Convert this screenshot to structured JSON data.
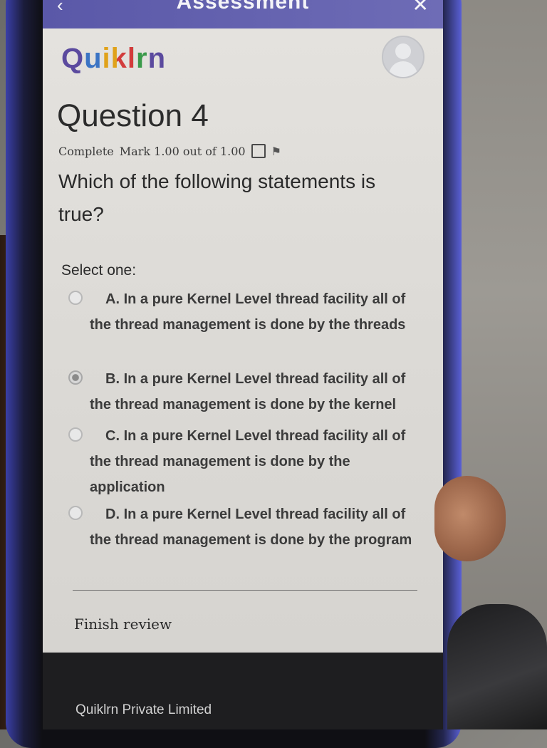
{
  "topbar": {
    "title": "Assessment",
    "back_icon": "chevron-left-icon",
    "close_icon": "close-icon"
  },
  "brand": {
    "logo_text_q": "Q",
    "logo_text_rest": "uiklrn"
  },
  "question": {
    "title": "Question 4",
    "status": "Complete",
    "mark": "Mark 1.00 out of 1.00",
    "text": "Which of the following statements is true?"
  },
  "prompt": "Select one:",
  "options": [
    {
      "letter": "A.",
      "text": "In a pure Kernel Level thread facility all of the thread management is done by the threads",
      "selected": false
    },
    {
      "letter": "B.",
      "text": "In a pure Kernel Level thread facility all of the thread management is done by the kernel",
      "selected": true
    },
    {
      "letter": "C.",
      "text": "In a pure Kernel Level thread facility all of the thread management is done by the application",
      "selected": false
    },
    {
      "letter": "D.",
      "text": "In a pure Kernel Level thread facility all of the thread management is done by the program",
      "selected": false
    }
  ],
  "actions": {
    "finish_review": "Finish review"
  },
  "footer": {
    "company": "Quiklrn Private Limited"
  }
}
